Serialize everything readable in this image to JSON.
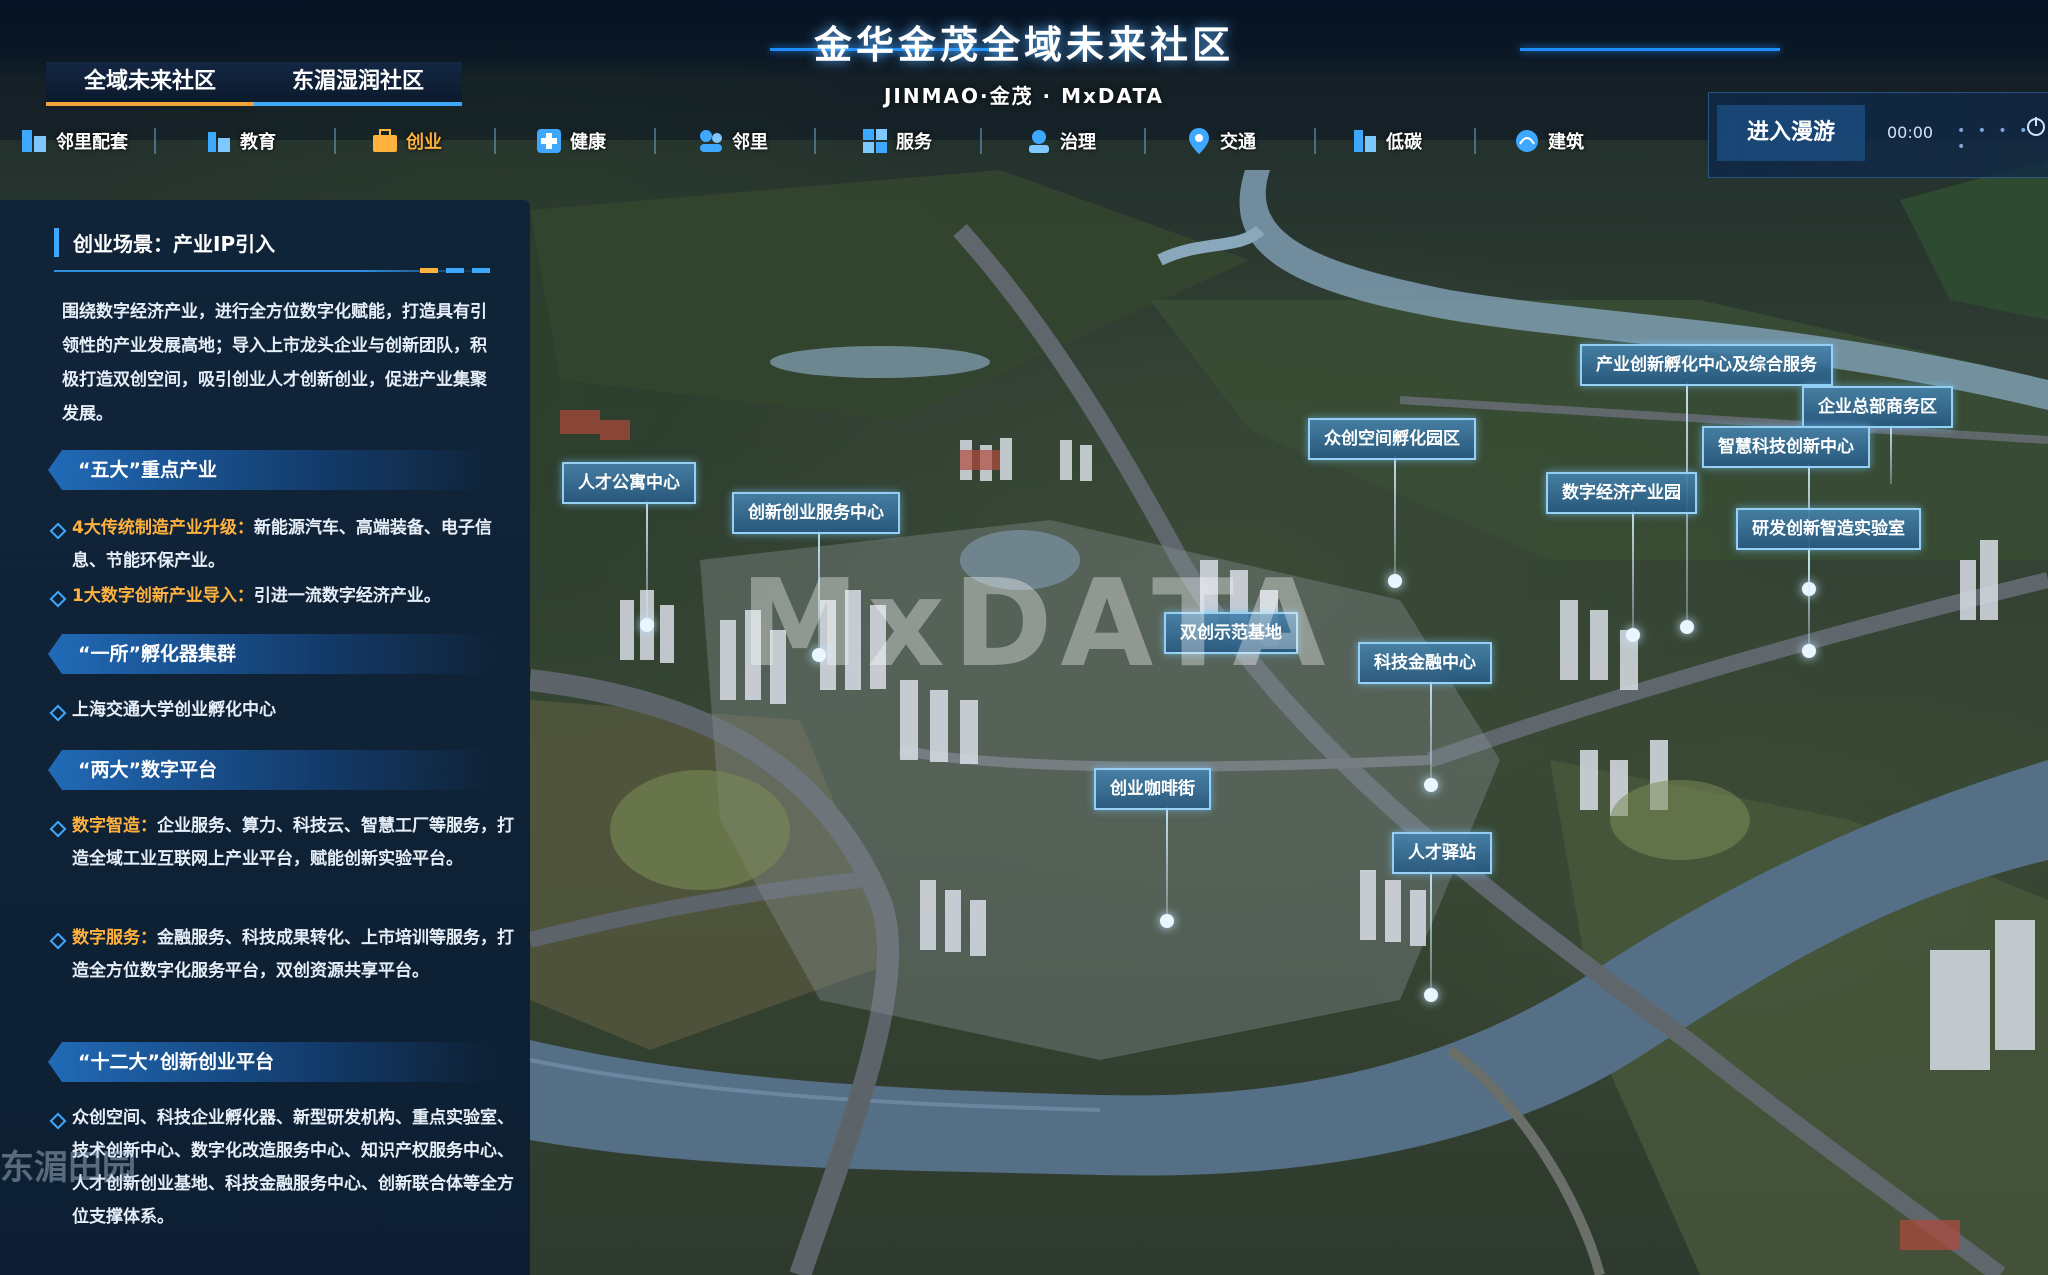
{
  "header": {
    "title": "金华金茂全域未来社区",
    "subtitle": "JINMAO·金茂 · MxDATA"
  },
  "top_tabs": [
    {
      "label": "全域未来社区",
      "active": true
    },
    {
      "label": "东湄湿润社区",
      "active": false
    }
  ],
  "nav": [
    {
      "label": "邻里配套",
      "icon": "building-icon"
    },
    {
      "label": "教育",
      "icon": "school-icon"
    },
    {
      "label": "创业",
      "icon": "briefcase-icon"
    },
    {
      "label": "健康",
      "icon": "health-icon"
    },
    {
      "label": "邻里",
      "icon": "community-icon"
    },
    {
      "label": "服务",
      "icon": "service-icon"
    },
    {
      "label": "治理",
      "icon": "governance-icon"
    },
    {
      "label": "交通",
      "icon": "location-pin-icon"
    },
    {
      "label": "低碳",
      "icon": "leaf-icon"
    },
    {
      "label": "建筑",
      "icon": "architecture-icon"
    }
  ],
  "controls": {
    "enter_label": "进入漫游",
    "time": "00:00"
  },
  "panel": {
    "title": "创业场景：产业IP引入",
    "intro": "围绕数字经济产业，进行全方位数字化赋能，打造具有引领性的产业发展高地；导入上市龙头企业与创新团队，积极打造双创空间，吸引创业人才创新创业，促进产业集聚发展。",
    "sections": [
      {
        "head": "“五大”重点产业",
        "bullets": [
          {
            "hl": "4大传统制造产业升级：",
            "text": "新能源汽车、高端装备、电子信息、节能环保产业。"
          },
          {
            "hl": "1大数字创新产业导入：",
            "text": "引进一流数字经济产业。"
          }
        ]
      },
      {
        "head": "“一所”孵化器集群",
        "bullets": [
          {
            "hl": "",
            "text": "上海交通大学创业孵化中心"
          }
        ]
      },
      {
        "head": "“两大”数字平台",
        "bullets": [
          {
            "hl": "数字智造：",
            "text": "企业服务、算力、科技云、智慧工厂等服务，打造全域工业互联网上产业平台，赋能创新实验平台。"
          },
          {
            "hl": "数字服务：",
            "text": "金融服务、科技成果转化、上市培训等服务，打造全方位数字化服务平台，双创资源共享平台。"
          }
        ]
      },
      {
        "head": "“十二大”创新创业平台",
        "bullets": [
          {
            "hl": "",
            "text": "众创空间、科技企业孵化器、新型研发机构、重点实验室、技术创新中心、数字化改造服务中心、知识产权服务中心、人才创新创业基地、科技金融服务中心、创新联合体等全方位支撑体系。"
          }
        ]
      }
    ]
  },
  "map_labels": [
    {
      "text": "人才公寓中心"
    },
    {
      "text": "创新创业服务中心"
    },
    {
      "text": "众创空间孵化园区"
    },
    {
      "text": "产业创新孵化中心及综合服务"
    },
    {
      "text": "企业总部商务区"
    },
    {
      "text": "智慧科技创新中心"
    },
    {
      "text": "数字经济产业园"
    },
    {
      "text": "研发创新智造实验室"
    },
    {
      "text": "双创示范基地"
    },
    {
      "text": "科技金融中心"
    },
    {
      "text": "创业咖啡街"
    },
    {
      "text": "人才驿站"
    }
  ],
  "watermarks": {
    "center": "MxDATA",
    "left": "东湄田园"
  },
  "colors": {
    "accent_blue": "#3ea8ff",
    "accent_orange": "#ffb23e",
    "panel_bg": "#0e223a"
  }
}
